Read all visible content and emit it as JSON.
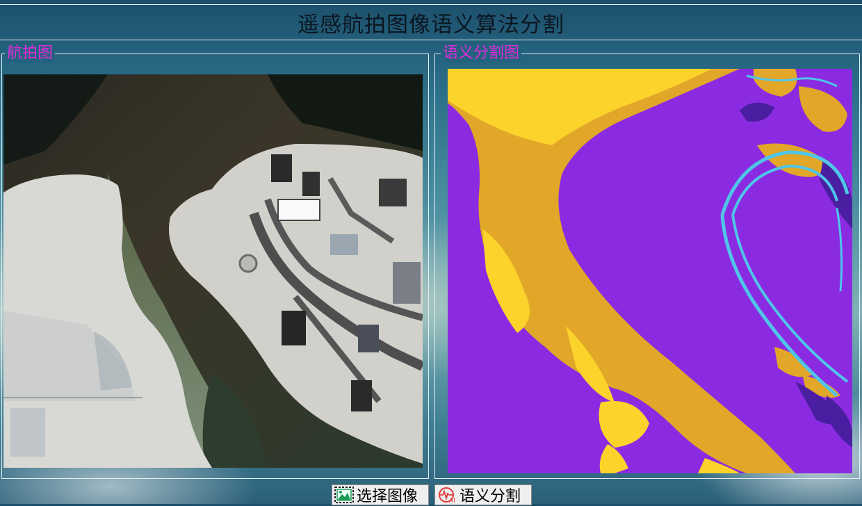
{
  "window": {
    "title": "遥感航拍图像语义算法分割"
  },
  "panels": {
    "left_title": "航拍图",
    "right_title": "语义分割图"
  },
  "buttons": {
    "select_image_label": "选择图像",
    "segment_label": "语义分割",
    "select_image_icon": "image-picture-icon",
    "segment_icon": "ai-waveform-icon"
  },
  "colors": {
    "title_text": "#0b1620",
    "group_title": "#e02cd8",
    "seg_background": "#8a2be2",
    "seg_land": "#e2a628",
    "seg_land_light": "#fbd32a",
    "seg_road": "#4fc6e8",
    "seg_building": "#4a1ea0"
  }
}
